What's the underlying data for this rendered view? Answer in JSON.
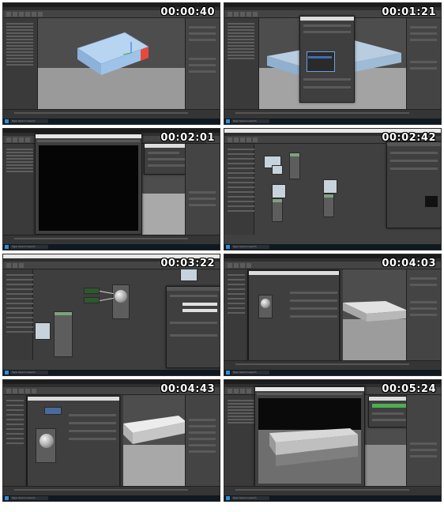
{
  "sheet": {
    "search_placeholder": "Type here to search",
    "tiles": [
      {
        "timestamp": "00:00:40"
      },
      {
        "timestamp": "00:01:21"
      },
      {
        "timestamp": "00:02:01"
      },
      {
        "timestamp": "00:02:42"
      },
      {
        "timestamp": "00:03:22"
      },
      {
        "timestamp": "00:04:03"
      },
      {
        "timestamp": "00:04:43"
      },
      {
        "timestamp": "00:05:24"
      }
    ]
  },
  "colors": {
    "box_blue": "#9fc3e8",
    "box_edge_red": "#e8483a",
    "render_black": "#050505",
    "node_green": "#7ea27e"
  }
}
